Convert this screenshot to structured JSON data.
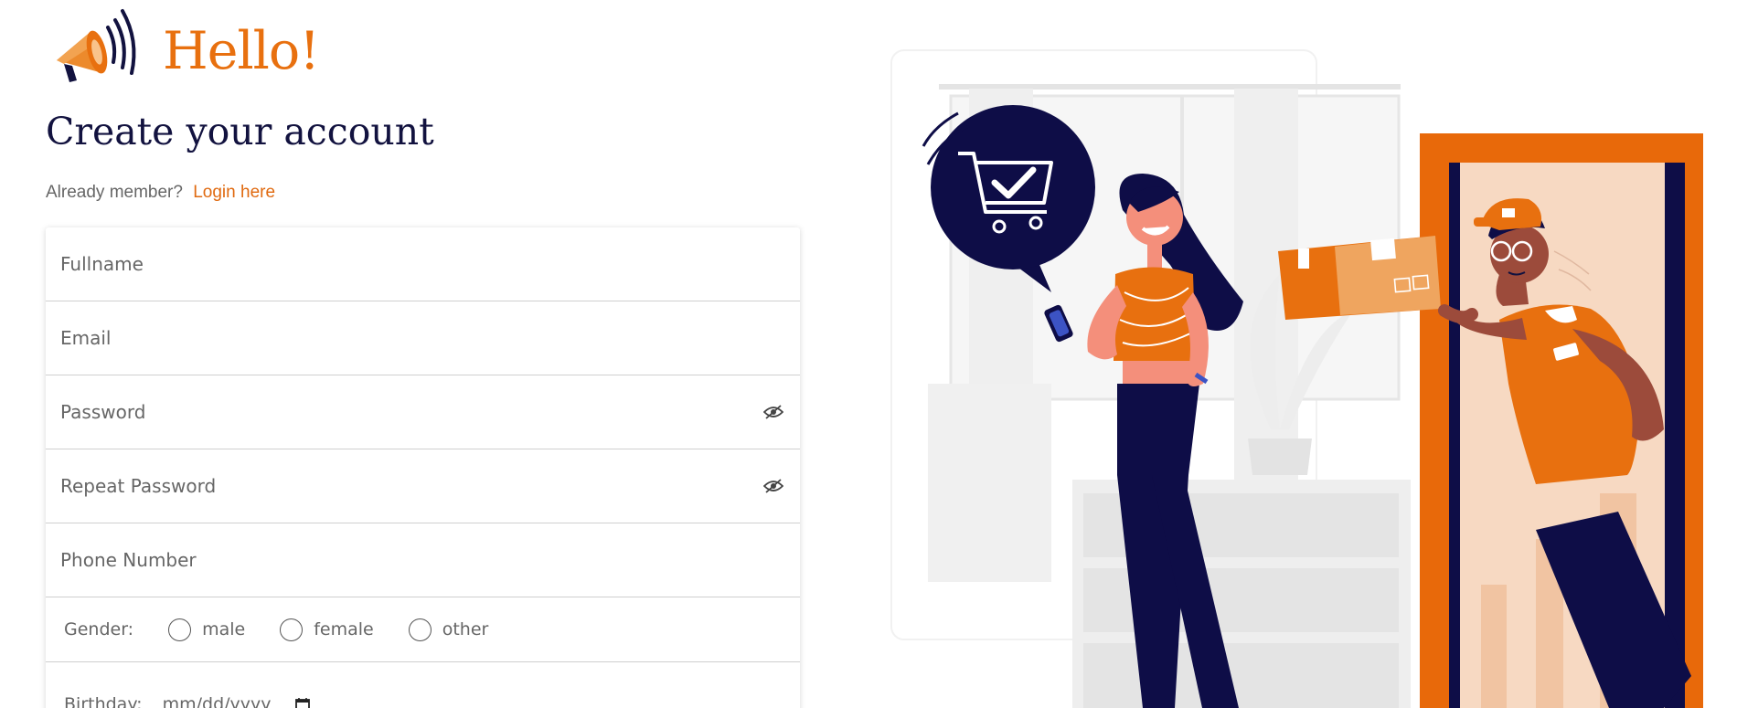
{
  "header": {
    "greeting": "Hello!",
    "title": "Create your account",
    "member_text": "Already member?",
    "login_link": "Login here"
  },
  "form": {
    "fullname_placeholder": "Fullname",
    "email_placeholder": "Email",
    "password_placeholder": "Password",
    "repeat_password_placeholder": "Repeat Password",
    "phone_placeholder": "Phone Number",
    "gender_label": "Gender:",
    "gender_options": [
      "male",
      "female",
      "other"
    ],
    "birthday_label": "Birthday:",
    "birthday_placeholder": "mm/dd/yyyy"
  },
  "icons": [
    "megaphone-icon",
    "eye-slash-icon",
    "calendar-icon",
    "shopping-cart-check-icon"
  ],
  "colors": {
    "accent": "#e8700f",
    "navy": "#12123f",
    "border": "#cfcfcf"
  }
}
